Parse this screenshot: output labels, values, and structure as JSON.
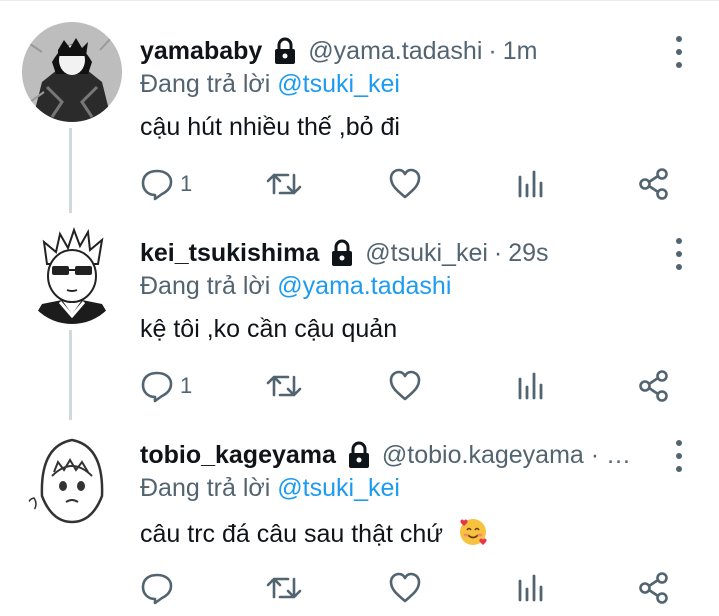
{
  "tweets": [
    {
      "display_name": "yamababy",
      "handle": "@yama.tadashi",
      "separator": "·",
      "time": "1m",
      "reply_prefix": "Đang trả lời",
      "reply_to": "@tsuki_kei",
      "text": "cậu hút nhiều thế ,bỏ đi",
      "reply_count": "1",
      "locked": true
    },
    {
      "display_name": "kei_tsukishima",
      "handle": "@tsuki_kei",
      "separator": "·",
      "time": "29s",
      "reply_prefix": "Đang trả lời",
      "reply_to": "@yama.tadashi",
      "text": "kệ tôi ,ko cần cậu quản",
      "reply_count": "1",
      "locked": true
    },
    {
      "display_name": "tobio_kageyama",
      "handle": "@tobio.kageyama · …",
      "reply_prefix": "Đang trả lời",
      "reply_to": "@tsuki_kei",
      "text": "câu trc đá câu sau thật chứ",
      "emoji": "smiling-face-with-hearts",
      "reply_count": "",
      "locked": true
    }
  ],
  "icons": {
    "reply": "speech-bubble-icon",
    "retweet": "retweet-icon",
    "like": "heart-icon",
    "views": "bar-chart-icon",
    "share": "share-icon",
    "more": "more-vertical-icon",
    "lock": "lock-icon"
  },
  "colors": {
    "text": "#0f1419",
    "secondary": "#536471",
    "mention": "#1d9bf0",
    "thread_line": "#cfd9de"
  }
}
